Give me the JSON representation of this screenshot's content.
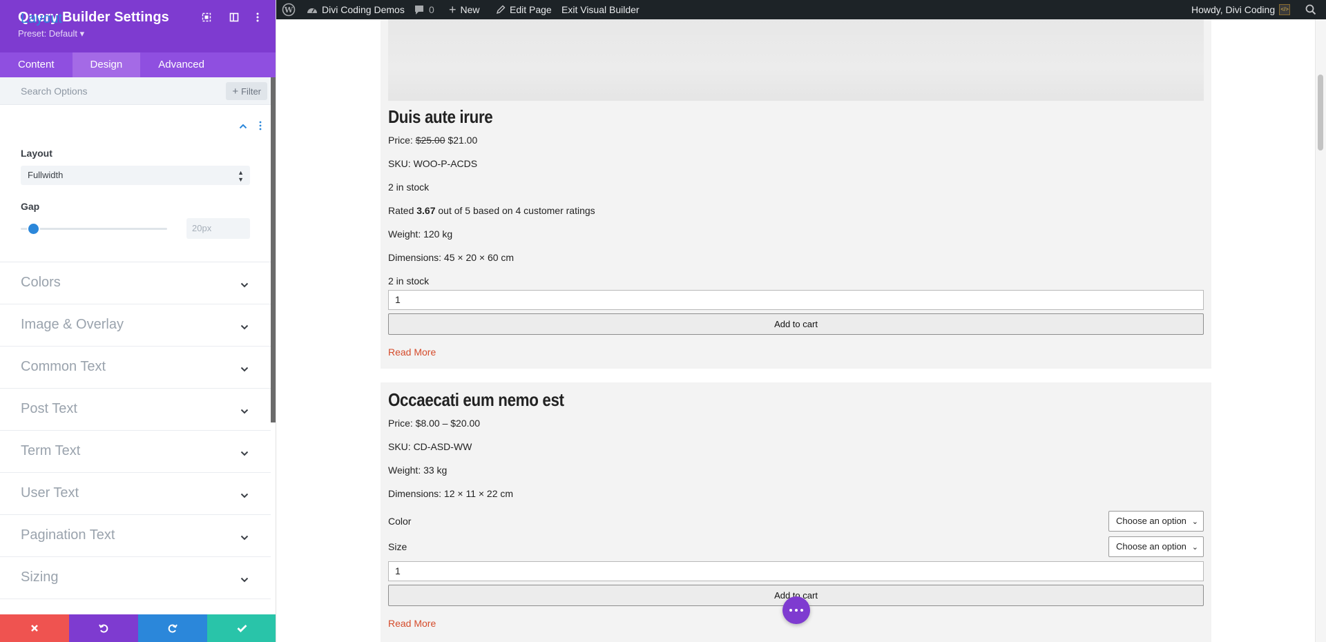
{
  "panel": {
    "title": "Query Builder Settings",
    "preset": "Preset: Default ▾",
    "tabs": [
      {
        "label": "Content"
      },
      {
        "label": "Design"
      },
      {
        "label": "Advanced"
      }
    ],
    "search_placeholder": "Search Options",
    "filter_label": "Filter",
    "layout_section": {
      "title": "Layout",
      "layout_label": "Layout",
      "layout_value": "Fullwidth",
      "gap_label": "Gap",
      "gap_value": "20px",
      "gap_level": 0.05
    },
    "groups": [
      {
        "label": "Colors"
      },
      {
        "label": "Image & Overlay"
      },
      {
        "label": "Common Text"
      },
      {
        "label": "Post Text"
      },
      {
        "label": "Term Text"
      },
      {
        "label": "User Text"
      },
      {
        "label": "Pagination Text"
      },
      {
        "label": "Sizing"
      }
    ],
    "footer_colors": [
      "#ef5350",
      "#7e3bd0",
      "#2b87da",
      "#29c4a9"
    ]
  },
  "adminbar": {
    "site_name": "Divi Coding Demos",
    "comments_count": "0",
    "new_label": "New",
    "edit_label": "Edit Page",
    "exit_label": "Exit Visual Builder",
    "howdy": "Howdy, Divi Coding"
  },
  "products": [
    {
      "title": "Duis aute irure",
      "price_prefix": "Price: ",
      "price_old": "$25.00",
      "price_new": " $21.00",
      "sku": "SKU: WOO-P-ACDS",
      "stock": "2 in stock",
      "rated_prefix": "Rated ",
      "rated_value": "3.67",
      "rated_suffix": " out of 5 based on 4 customer ratings",
      "weight": "Weight: 120 kg",
      "dimensions": "Dimensions: 45 × 20 × 60 cm",
      "stock2": "2 in stock",
      "qty": "1",
      "cart_label": "Add to cart",
      "read_more": "Read More"
    },
    {
      "title": "Occaecati eum nemo est",
      "price": "Price: $8.00 – $20.00",
      "sku": "SKU: CD-ASD-WW",
      "weight": "Weight: 33 kg",
      "dimensions": "Dimensions: 12 × 11 × 22 cm",
      "color_label": "Color",
      "color_value": "Choose an option",
      "size_label": "Size",
      "size_value": "Choose an option",
      "qty": "1",
      "cart_label": "Add to cart",
      "read_more": "Read More"
    }
  ],
  "colors": {
    "divi_purple": "#7e3bd0",
    "accent_blue": "#2b87da",
    "read_more": "#d54b2b"
  }
}
